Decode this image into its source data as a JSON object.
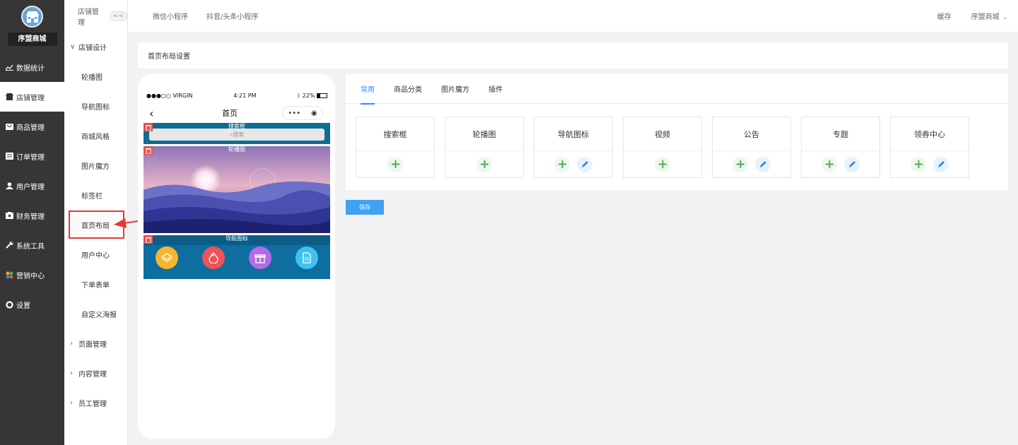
{
  "sidebar": {
    "brand": "序盟商城",
    "items": [
      {
        "label": "数据统计",
        "icon": "chart-icon"
      },
      {
        "label": "店铺管理",
        "icon": "store-icon"
      },
      {
        "label": "商品管理",
        "icon": "goods-icon"
      },
      {
        "label": "订单管理",
        "icon": "order-icon"
      },
      {
        "label": "用户管理",
        "icon": "user-icon"
      },
      {
        "label": "财务管理",
        "icon": "finance-icon"
      },
      {
        "label": "系统工具",
        "icon": "wrench-icon"
      },
      {
        "label": "营销中心",
        "icon": "marketing-icon"
      },
      {
        "label": "设置",
        "icon": "gear-icon"
      }
    ]
  },
  "subnav": {
    "header": "店铺管理",
    "collapse": "<<",
    "group_open": "店铺设计",
    "items": [
      "轮播图",
      "导航图标",
      "商城风格",
      "图片魔方",
      "标签栏",
      "首页布局",
      "用户中心",
      "下单表单",
      "自定义海报"
    ],
    "groups": [
      "页面管理",
      "内容管理",
      "员工管理"
    ]
  },
  "topbar": {
    "tabs": [
      "微信小程序",
      "抖音/头条小程序"
    ],
    "cache": "缓存",
    "store": "序盟商城"
  },
  "crumb": "首页布局设置",
  "phone": {
    "carrier": "●●●○○ VIRGIN",
    "time": "4:21 PM",
    "battery": "22%",
    "title": "首页",
    "search_label": "搜索框",
    "search_placeholder": "搜索",
    "banner_label": "轮播图",
    "nav_label": "导航图标"
  },
  "panel": {
    "tabs": [
      "常用",
      "商品分类",
      "图片魔方",
      "插件"
    ],
    "cards": [
      "搜索框",
      "轮播图",
      "导航图标",
      "视频",
      "公告",
      "专题",
      "领券中心"
    ]
  },
  "save_label": "保存",
  "colors": {
    "accent": "#2d8cf0",
    "sidebar": "#363636",
    "highlight": "#e53935",
    "add": "#4caf50"
  }
}
